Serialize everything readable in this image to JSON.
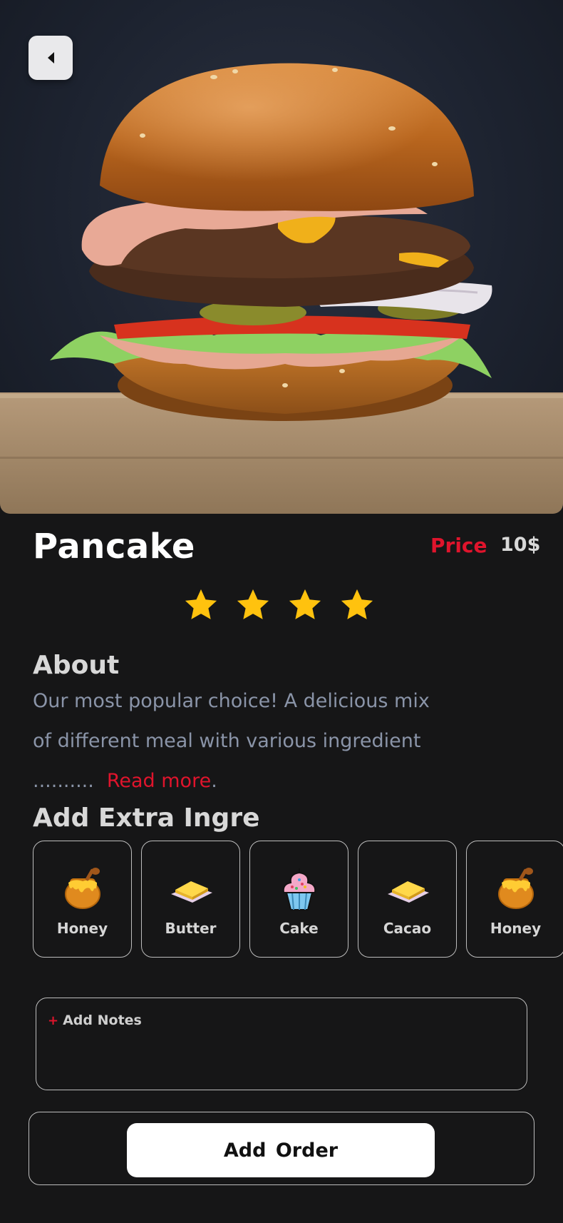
{
  "product": {
    "name": "Pancake",
    "price_label": "Price",
    "price_value": "10$",
    "rating": 4
  },
  "about": {
    "title": "About",
    "text": "Our most popular choice! A delicious mix of different meal with various ingredient ..........",
    "read_more": "Read more",
    "trailing": "."
  },
  "extras": {
    "title": "Add Extra Ingre",
    "items": [
      {
        "label": "Honey",
        "icon": "honey-pot-icon"
      },
      {
        "label": "Butter",
        "icon": "butter-icon"
      },
      {
        "label": "Cake",
        "icon": "cupcake-icon"
      },
      {
        "label": "Cacao",
        "icon": "butter-icon"
      },
      {
        "label": "Honey",
        "icon": "honey-pot-icon"
      }
    ]
  },
  "notes": {
    "plus": "+",
    "label": "Add Notes"
  },
  "order": {
    "button_label": "Add Order"
  },
  "colors": {
    "background": "#161617",
    "accent": "#e0142c",
    "star": "#ffc20e",
    "muted_text": "#8a94a8"
  }
}
